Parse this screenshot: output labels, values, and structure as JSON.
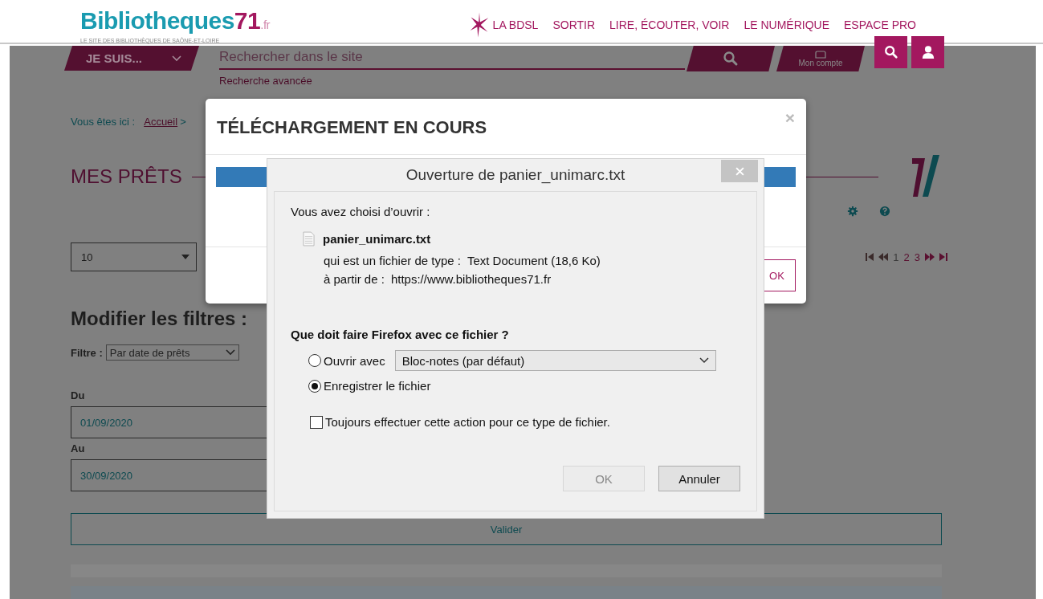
{
  "header": {
    "logo": {
      "name": "Bibliotheques",
      "number": "71",
      "suffix": ".fr",
      "tagline": "LE SITE DES BIBLIOTHÈQUES DE SAÔNE-ET-LOIRE"
    },
    "nav": [
      "LA BDSL",
      "SORTIR",
      "LIRE, ÉCOUTER, VOIR",
      "LE NUMÉRIQUE",
      "ESPACE PRO"
    ]
  },
  "toolbar": {
    "menu_button": "JE SUIS...",
    "search": {
      "placeholder": "Rechercher dans le site"
    },
    "account_label": "Mon compte",
    "advanced_search": "Recherche avancée"
  },
  "breadcrumb": {
    "label": "Vous êtes ici :",
    "items": [
      "Accueil"
    ],
    "separator": ">"
  },
  "page_title": "MES PRÊTS",
  "per_page": "10",
  "pagination": {
    "pages": [
      {
        "label": "1",
        "selected": true
      },
      {
        "label": "2",
        "selected": false
      },
      {
        "label": "3",
        "selected": false
      }
    ]
  },
  "filters": {
    "title": "Modifier les filtres :",
    "filter_label": "Filtre :",
    "filter_value": "Par date de prêts",
    "from_label": "Du",
    "from_value": "01/09/2020",
    "to_label": "Au",
    "to_value": "30/09/2020",
    "submit": "Valider"
  },
  "download_modal": {
    "title": "TÉLÉCHARGEMENT EN COURS",
    "close": "×",
    "progress": {
      "level": 1
    },
    "ok": "OK"
  },
  "file_dialog": {
    "title": "Ouverture de panier_unimarc.txt",
    "intro": "Vous avez choisi d’ouvrir :",
    "file_name": "panier_unimarc.txt",
    "type_label": "qui est un fichier de type :",
    "type_value": "Text Document (18,6 Ko)",
    "source_label": "à partir de :",
    "source_value": "https://www.bibliotheques71.fr",
    "question": "Que doit faire Firefox avec ce fichier ?",
    "options": [
      {
        "label": "Ouvrir avec",
        "selected": false,
        "app": "Bloc-notes (par défaut)"
      },
      {
        "label": "Enregistrer le fichier",
        "selected": true
      }
    ],
    "always": {
      "label": "Toujours effectuer cette action pour ce type de fichier.",
      "checked": false
    },
    "buttons": [
      {
        "label": "OK",
        "disabled": true
      },
      {
        "label": "Annuler",
        "disabled": false
      }
    ]
  }
}
